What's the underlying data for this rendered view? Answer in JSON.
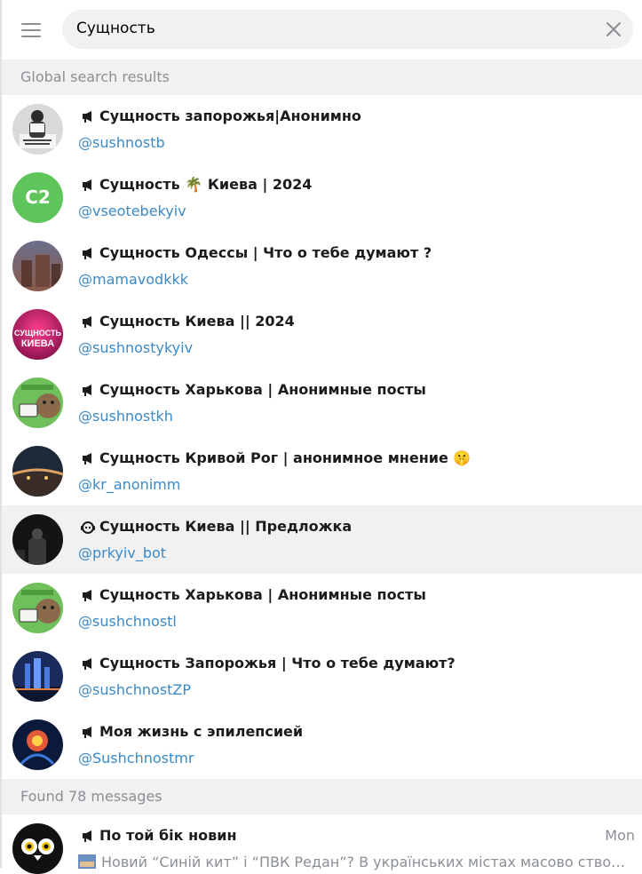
{
  "search": {
    "query": "Сущность"
  },
  "global_header": "Global search results",
  "results": [
    {
      "title": "Сущность запорожья|Анонимно",
      "username": "@sushnostb",
      "type": "channel",
      "avatar": "photo-person"
    },
    {
      "title": "Сущность 🌴 Киева | 2024",
      "username": "@vseotebekyiv",
      "type": "channel",
      "avatar_initials": "C2",
      "avatar_color": "#5dc55a"
    },
    {
      "title": "Сущность Одессы | Что о тебе думают ?",
      "username": "@mamavodkkk",
      "type": "channel",
      "avatar": "photo-city"
    },
    {
      "title": "Сущность Киева || 2024",
      "username": "@sushnostykyiv",
      "type": "channel",
      "avatar": "pink-logo",
      "avatar_text": "СУЩНОСТЬ КИЕВА"
    },
    {
      "title": "Сущность Харькова | Анонимные посты",
      "username": "@sushnostkh",
      "type": "channel",
      "avatar": "green-cartoon"
    },
    {
      "title": "Сущность Кривой Рог | анонимное мнение 🤫",
      "username": "@kr_anonimm",
      "type": "channel",
      "avatar": "photo-night-bridge"
    },
    {
      "title": "Сущность Киева || Предложка",
      "username": "@prkyiv_bot",
      "type": "bot",
      "avatar": "photo-dark"
    },
    {
      "title": "Сущность Харькова | Анонимные посты",
      "username": "@sushchnostl",
      "type": "channel",
      "avatar": "green-cartoon"
    },
    {
      "title": "Сущность Запорожья | Что о тебе думают?",
      "username": "@sushchnostZP",
      "type": "channel",
      "avatar": "photo-night-city"
    },
    {
      "title": "Моя жизнь с эпилепсией",
      "username": "@Sushchnostmr",
      "type": "channel",
      "avatar": "photo-brain"
    }
  ],
  "messages_header": "Found 78 messages",
  "message_results": [
    {
      "title": "По той бік новин",
      "date": "Mon",
      "snippet": "Новий “Синій кит” і “ПВК Редан”? В українських містах масово створюють те...",
      "avatar": "owl-logo"
    }
  ],
  "colors": {
    "link": "#3a8ac9",
    "muted": "#8a8f95",
    "header_bg": "#f1f1f1",
    "selected_bg": "#f1f1f1"
  }
}
